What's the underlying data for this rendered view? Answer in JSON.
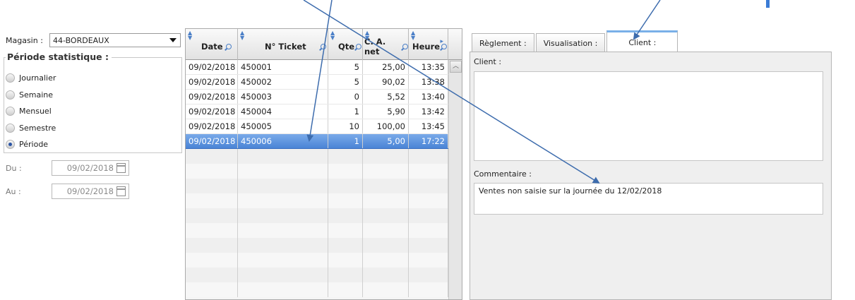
{
  "left": {
    "magasin_label": "Magasin :",
    "magasin_value": "44-BORDEAUX",
    "periode_title": "Période statistique :",
    "radios": [
      {
        "label": "Journalier",
        "checked": false
      },
      {
        "label": "Semaine",
        "checked": false
      },
      {
        "label": "Mensuel",
        "checked": false
      },
      {
        "label": "Semestre",
        "checked": false
      },
      {
        "label": "Période",
        "checked": true
      }
    ],
    "du_label": "Du :",
    "du_value": "09/02/2018",
    "au_label": "Au :",
    "au_value": "09/02/2018"
  },
  "grid": {
    "headers": [
      "Date",
      "N° Ticket",
      "Qte",
      "C. A. net",
      "Heure"
    ],
    "rows": [
      [
        "09/02/2018",
        "450001",
        "5",
        "25,00",
        "13:35"
      ],
      [
        "09/02/2018",
        "450002",
        "5",
        "90,02",
        "13:38"
      ],
      [
        "09/02/2018",
        "450003",
        "0",
        "5,52",
        "13:40"
      ],
      [
        "09/02/2018",
        "450004",
        "1",
        "5,90",
        "13:42"
      ],
      [
        "09/02/2018",
        "450005",
        "10",
        "100,00",
        "13:45"
      ],
      [
        "09/02/2018",
        "450006",
        "1",
        "5,00",
        "17:22"
      ]
    ],
    "selected_row": 5
  },
  "tabs": {
    "items": [
      "Règlement :",
      "Visualisation :",
      "Client :"
    ],
    "active": 2
  },
  "client_pane": {
    "client_label": "Client :",
    "client_value": "",
    "commentaire_label": "Commentaire :",
    "commentaire_value": "Ventes non saisie sur la journée du 12/02/2018"
  },
  "colors": {
    "arrow": "#3d6cad",
    "selection": "#4a84d6",
    "tab_accent": "#7ab0e8"
  }
}
